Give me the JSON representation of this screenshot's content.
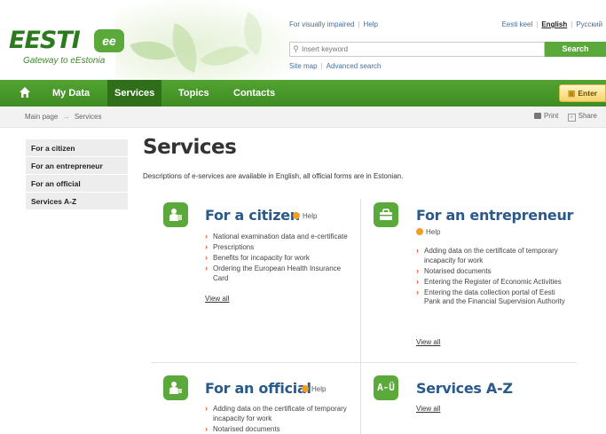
{
  "header": {
    "logo_text": "EESTI",
    "logo_badge": "ee",
    "logo_tagline": "Gateway to eEstonia",
    "top_links": [
      "For visually impaired",
      "Help"
    ],
    "languages": [
      "Eesti keel",
      "English",
      "Русский"
    ],
    "search": {
      "placeholder": "Insert keyword",
      "button": "Search"
    },
    "sub_links": [
      "Site map",
      "Advanced search"
    ]
  },
  "nav": {
    "items": [
      "My Data",
      "Services",
      "Topics",
      "Contacts"
    ],
    "enter": "Enter"
  },
  "breadcrumb": {
    "home": "Main page",
    "arrow": "→",
    "current": "Services"
  },
  "tools": {
    "print": "Print",
    "share": "Share"
  },
  "sidebar": {
    "items": [
      "For a citizen",
      "For an entrepreneur",
      "For an official",
      "Services A-Z"
    ]
  },
  "main": {
    "title": "Services",
    "description": "Descriptions of e-services are available in English, all official forms are in Estonian.",
    "help_label": "Help",
    "view_all": "View all",
    "categories": [
      {
        "title": "For a citizen",
        "items": [
          "National examination data and e-certificate",
          "Prescriptions",
          "Benefits for incapacity for work",
          "Ordering the European Health Insurance Card"
        ]
      },
      {
        "title": "For an entrepreneur",
        "items": [
          "Adding data on the certificate of temporary incapacity for work",
          "Notarised documents",
          "Entering the Register of Economic Activities",
          "Entering the data collection portal of Eesti Pank and the Financial Supervision Authority"
        ]
      },
      {
        "title": "For an official",
        "items": [
          "Adding data on the certificate of temporary incapacity for work",
          "Notarised documents"
        ]
      },
      {
        "title": "Services A-Z",
        "icon_text": "A-Ü",
        "items": []
      }
    ]
  },
  "colors": {
    "brand_green": "#5aa93a",
    "nav_green": "#3f8c22",
    "link_blue": "#2a5a8c",
    "bullet_orange": "#e85a1b"
  }
}
